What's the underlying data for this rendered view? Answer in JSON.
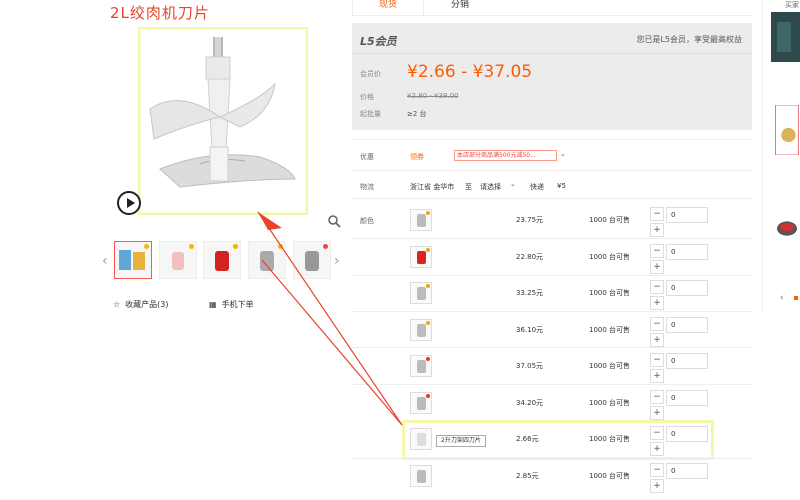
{
  "annotation": {
    "title": "2L绞肉机刀片"
  },
  "gallery": {
    "thumbs_count": 5,
    "favorite_label": "收藏产品(3)",
    "mobile_order_label": "手机下单"
  },
  "tabs": [
    {
      "label": "现货",
      "active": true
    },
    {
      "label": "分销",
      "active": false
    }
  ],
  "member": {
    "logo": "L5会员",
    "note": "您已是L5会员，享受最高权益",
    "member_price_label": "会员价",
    "member_price": "¥2.66 - ¥37.05",
    "price_label": "价格",
    "original_price": "¥2.80 - ¥39.00",
    "moq_label": "起批量",
    "moq": "≥2 台"
  },
  "promo": {
    "label": "优惠",
    "tag": "领券",
    "text": "本店部分商品满500元减50..."
  },
  "logistics": {
    "label": "物流",
    "origin": "浙江省 金华市",
    "to": "至",
    "select": "请选择",
    "express": "快递",
    "fee": "¥5"
  },
  "color_label": "颜色",
  "sku": [
    {
      "price": "23.75元",
      "stock": "1000 台可售",
      "qty": "0",
      "thumb": "grey"
    },
    {
      "price": "22.80元",
      "stock": "1000 台可售",
      "qty": "0",
      "thumb": "red"
    },
    {
      "price": "33.25元",
      "stock": "1000 台可售",
      "qty": "0",
      "thumb": "grey"
    },
    {
      "price": "36.10元",
      "stock": "1000 台可售",
      "qty": "0",
      "thumb": "grey"
    },
    {
      "price": "37.05元",
      "stock": "1000 台可售",
      "qty": "0",
      "thumb": "grey"
    },
    {
      "price": "34.20元",
      "stock": "1000 台可售",
      "qty": "0",
      "thumb": "grey"
    },
    {
      "price": "2.66元",
      "stock": "1000 台可售",
      "qty": "0",
      "thumb": "grey",
      "tooltip": "2升刀架四刀片"
    },
    {
      "price": "2.85元",
      "stock": "1000 台可售",
      "qty": "0",
      "thumb": "grey"
    }
  ],
  "stepper": {
    "minus": "−",
    "plus": "+"
  },
  "right_panel": {
    "label": "买家"
  },
  "colors": {
    "accent": "#ff5b00",
    "highlight": "#f3f7a6",
    "annotation": "#e8432b"
  }
}
